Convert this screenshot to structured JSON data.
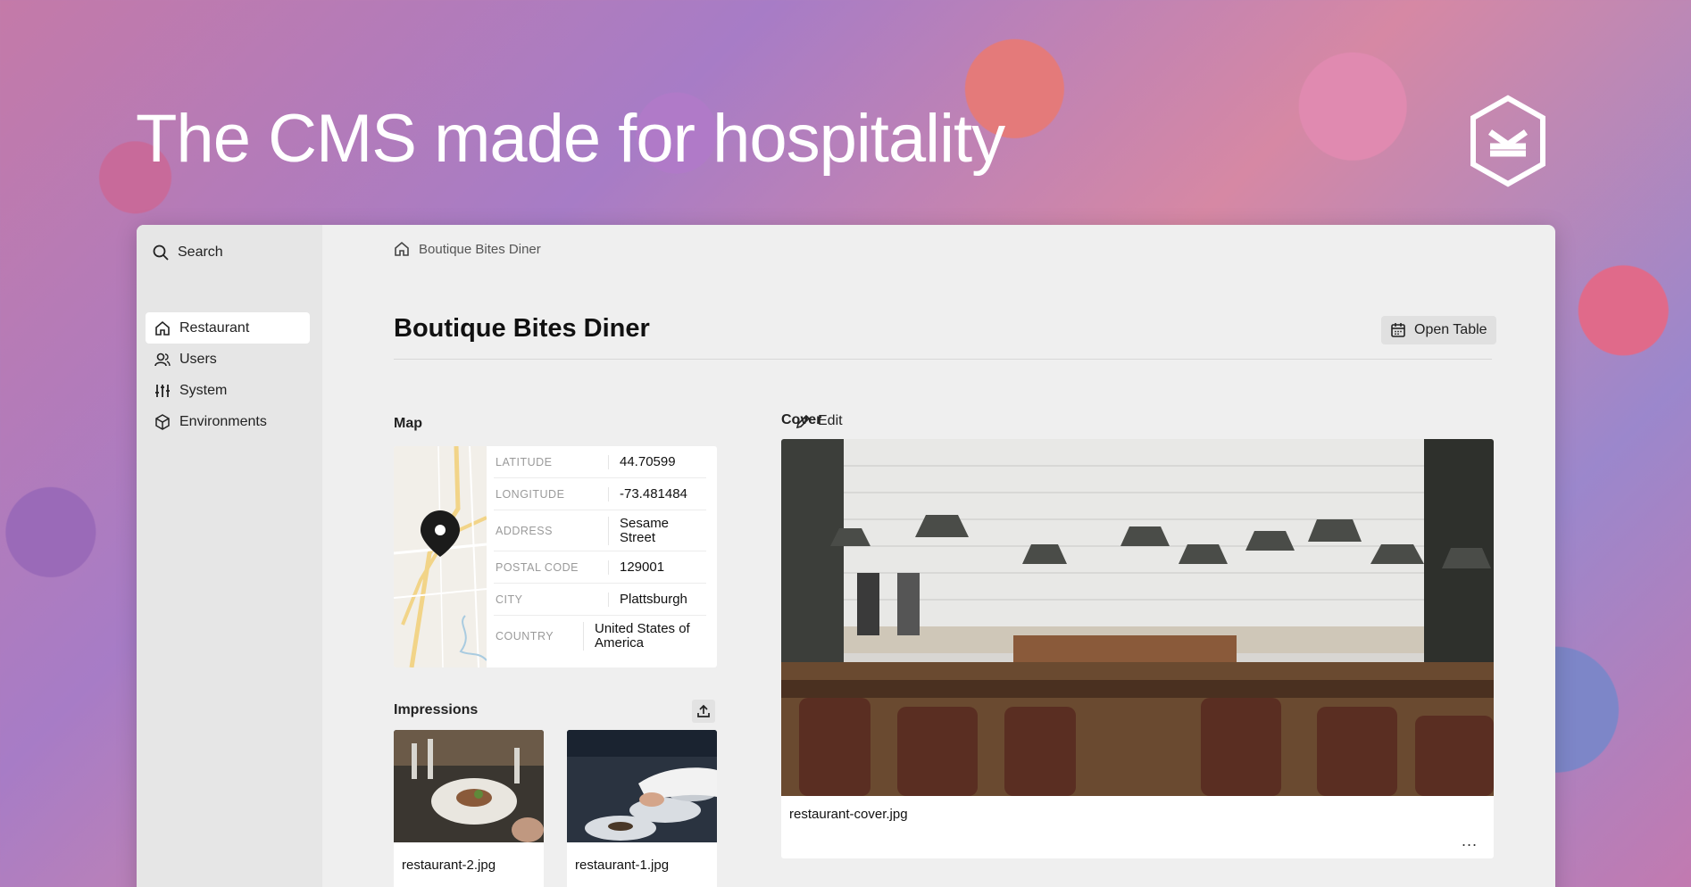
{
  "hero": {
    "title": "The CMS made for hospitality"
  },
  "sidebar": {
    "search_label": "Search",
    "items": [
      {
        "label": "Restaurant",
        "icon": "home-icon",
        "active": true
      },
      {
        "label": "Users",
        "icon": "users-icon",
        "active": false
      },
      {
        "label": "System",
        "icon": "sliders-icon",
        "active": false
      },
      {
        "label": "Environments",
        "icon": "cube-icon",
        "active": false
      }
    ]
  },
  "breadcrumb": {
    "label": "Boutique Bites Diner"
  },
  "header": {
    "title": "Boutique Bites Diner",
    "open_table_label": "Open Table"
  },
  "map": {
    "section_label": "Map",
    "edit_label": "Edit",
    "fields": [
      {
        "key": "LATITUDE",
        "value": "44.70599"
      },
      {
        "key": "LONGITUDE",
        "value": "-73.481484"
      },
      {
        "key": "ADDRESS",
        "value": "Sesame Street"
      },
      {
        "key": "POSTAL CODE",
        "value": "129001"
      },
      {
        "key": "CITY",
        "value": "Plattsburgh"
      },
      {
        "key": "COUNTRY",
        "value": "United States of America"
      }
    ]
  },
  "impressions": {
    "section_label": "Impressions",
    "items": [
      {
        "filename": "restaurant-2.jpg"
      },
      {
        "filename": "restaurant-1.jpg"
      }
    ]
  },
  "cover": {
    "section_label": "Cover",
    "filename": "restaurant-cover.jpg",
    "more_label": "..."
  }
}
